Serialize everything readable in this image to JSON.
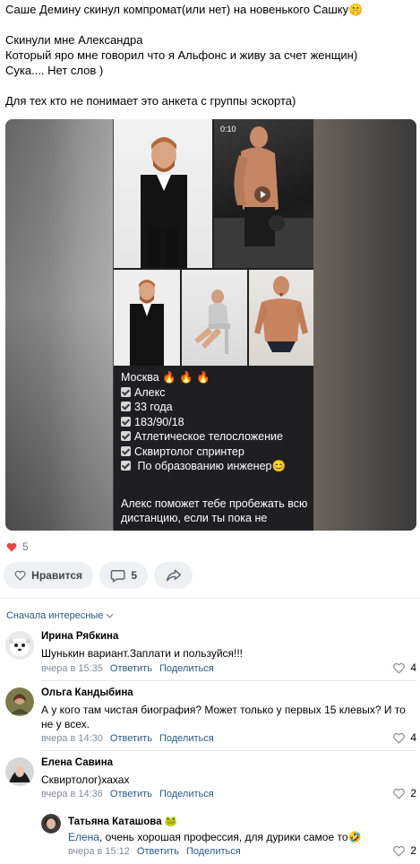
{
  "post": {
    "line1": "Саше Демину скинул компромат(или нет) на новенького Сашку🤫",
    "line2": "Скинули мне Александра",
    "line3": "Который яро мне говорил что я Альфонс и живу за счет женщин)",
    "line4": "Сука.... Нет слов )",
    "line5": "Для тех кто не понимает это анкета с группы эскорта)"
  },
  "media": {
    "video_time": "0:10",
    "ad_lines": [
      "Москва 🔥 🔥 🔥",
      "Алекс",
      "33 года",
      "183/90/18",
      "Атлетическое телосложение",
      "Сквиртолог спринтер",
      " По образованию инженер😊"
    ],
    "ad_tail": "Алекс поможет тебе пробежать всю дистанцию, если ты пока не"
  },
  "reactions": {
    "likes_count": "5",
    "like_button": "Нравится",
    "comment_count": "5"
  },
  "comments_sort": "Сначала интересные",
  "comments": [
    {
      "name": "Ирина Рябкина",
      "text": "Шунькин вариант.Заплати и пользуйся!!!",
      "time": "вчера в 15:35",
      "reply": "Ответить",
      "share": "Поделиться",
      "likes": "4"
    },
    {
      "name": "Ольга Кандыбина",
      "text": "А у кого там чистая биография? Может только у первых 15 клевых? И то не у всех.",
      "time": "вчера в 14:30",
      "reply": "Ответить",
      "share": "Поделиться",
      "likes": "4"
    },
    {
      "name": "Елена Савина",
      "text": "Сквиртолог)хахах",
      "time": "вчера в 14:36",
      "reply": "Ответить",
      "share": "Поделиться",
      "likes": "2"
    },
    {
      "name": "Татьяна Каташова",
      "badge": "🐸",
      "text_mention": "Елена",
      "text": ", очень хорошая профессия, для дурики самое то🤣",
      "time": "вчера в 15:12",
      "reply": "Ответить",
      "share": "Поделиться",
      "likes": "2"
    }
  ],
  "colors": {
    "link": "#2a5885",
    "meta": "#818c99",
    "button_bg": "#eef0f2",
    "heart": "#e64646"
  }
}
